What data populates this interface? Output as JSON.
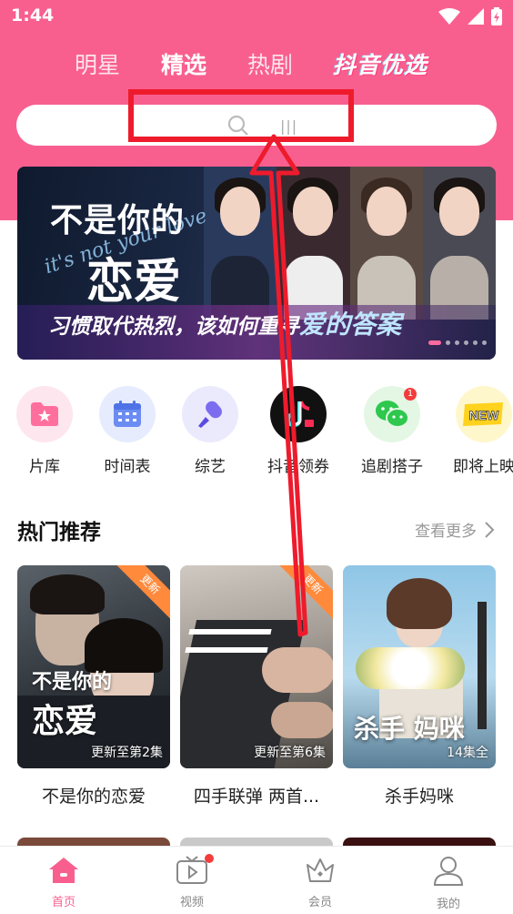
{
  "status_bar": {
    "time": "1:44"
  },
  "top_tabs": [
    {
      "label": "明星"
    },
    {
      "label": "精选"
    },
    {
      "label": "热剧"
    },
    {
      "label": "抖音优选"
    }
  ],
  "search": {
    "placeholder": ""
  },
  "banner": {
    "title_line1": "不是你的",
    "title_line2": "恋爱",
    "script_text": "it's not your love",
    "subtitle": "习惯取代热烈，该如何重寻",
    "subtitle_highlight": "爱的答案"
  },
  "categories": [
    {
      "label": "片库",
      "icon": "folder-star-icon"
    },
    {
      "label": "时间表",
      "icon": "calendar-icon"
    },
    {
      "label": "综艺",
      "icon": "microphone-icon"
    },
    {
      "label": "抖音领券",
      "icon": "douyin-logo-icon"
    },
    {
      "label": "追剧搭子",
      "icon": "wechat-icon"
    },
    {
      "label": "即将上映",
      "icon": "new-badge-icon"
    }
  ],
  "section": {
    "title": "热门推荐",
    "more": "查看更多"
  },
  "cards": [
    {
      "name": "不是你的恋爱",
      "episode": "更新至第2集",
      "ribbon": "更新",
      "poster_title1": "不是你的",
      "poster_title2": "恋爱"
    },
    {
      "name": "四手联弹 两首...",
      "episode": "更新至第6集",
      "ribbon": "更新"
    },
    {
      "name": "杀手妈咪",
      "episode": "14集全",
      "poster_title": "杀手 妈咪"
    }
  ],
  "bottom_nav": [
    {
      "label": "首页",
      "icon": "home-icon",
      "active": true
    },
    {
      "label": "视频",
      "icon": "tv-icon",
      "badge": true
    },
    {
      "label": "会员",
      "icon": "crown-icon"
    },
    {
      "label": "我的",
      "icon": "user-icon"
    }
  ],
  "colors": {
    "accent": "#f85f8f",
    "annotation": "#ee1b2c"
  }
}
